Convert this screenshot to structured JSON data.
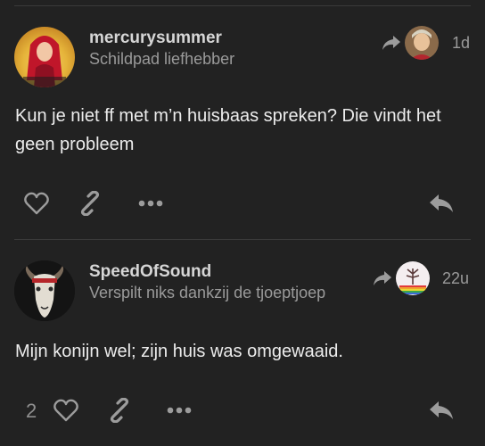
{
  "posts": [
    {
      "username": "mercurysummer",
      "user_title": "Schildpad liefhebber",
      "timestamp": "1d",
      "content": "Kun je niet ff met m’n huisbaas spreken? Die vindt het geen probleem",
      "like_count": ""
    },
    {
      "username": "SpeedOfSound",
      "user_title": "Verspilt niks dankzij de tjoeptjoep",
      "timestamp": "22u",
      "content": "Mijn konijn wel; zijn huis was omgewaaid.",
      "like_count": "2"
    }
  ],
  "icons": {
    "like": "heart-icon",
    "link": "link-icon",
    "more": "ellipsis-icon",
    "reply": "reply-icon",
    "reply_to": "reply-to-arrow-icon"
  },
  "colors": {
    "background": "#222222",
    "text": "#ececec",
    "muted": "#9a9a9a",
    "icon": "#9c9c9c"
  }
}
